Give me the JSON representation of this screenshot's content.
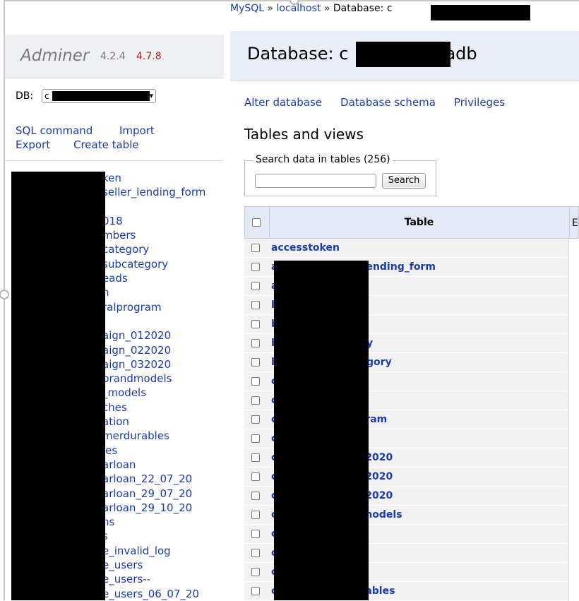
{
  "breadcrumb": {
    "part1": "MySQL",
    "sep1": " » ",
    "part2": "localhost",
    "sep2": " » ",
    "part3": "Database: c"
  },
  "brand": {
    "name": "Adminer",
    "version": "4.2.4",
    "new_version": "4.7.8"
  },
  "db_selector": {
    "label": "DB:",
    "value": "c"
  },
  "sidebar_links": {
    "sql_command": "SQL command",
    "import": "Import",
    "export": "Export",
    "create_table": "Create table"
  },
  "sidebar_tables": [
    "ken",
    "seller_lending_form",
    "",
    "018",
    "mbers",
    "category",
    "subcategory",
    "eads",
    "n",
    "ralprogram",
    "",
    "aign_012020",
    "aign_022020",
    "aign_032020",
    "brandmodels",
    "_models",
    "ches",
    "ation",
    "merdurables",
    "les",
    "arloan",
    "arloan_22_07_20",
    "arloan_29_07_20",
    "arloan_29_10_20",
    "ns",
    "s",
    "e_invalid_log",
    "e_users",
    "e_users--",
    "e_users_06_07_20"
  ],
  "main": {
    "title_prefix": "Database: c",
    "title_suffix": "adb",
    "actions": {
      "alter": "Alter database",
      "schema": "Database schema",
      "privileges": "Privileges"
    },
    "tables_heading": "Tables and views",
    "search": {
      "legend": "Search data in tables (256)",
      "button": "Search",
      "value": ""
    },
    "table_header": {
      "table": "Table",
      "engine_abbrev": "E"
    },
    "rows": [
      {
        "left": "accesstoken",
        "right": ""
      },
      {
        "left": "a",
        "right": "ending_form"
      },
      {
        "left": "a",
        "right": ""
      },
      {
        "left": "b",
        "right": ""
      },
      {
        "left": "b",
        "right": ""
      },
      {
        "left": "b",
        "right": "y"
      },
      {
        "left": "b",
        "right": "gory"
      },
      {
        "left": "c",
        "right": ""
      },
      {
        "left": "c",
        "right": ""
      },
      {
        "left": "c",
        "right": "ram"
      },
      {
        "left": "c",
        "right": ""
      },
      {
        "left": "c",
        "right": "2020"
      },
      {
        "left": "c",
        "right": "2020"
      },
      {
        "left": "c",
        "right": "2020"
      },
      {
        "left": "c",
        "right": "nodels"
      },
      {
        "left": "c",
        "right": ""
      },
      {
        "left": "c",
        "right": ""
      },
      {
        "left": "c",
        "right": ""
      },
      {
        "left": "c",
        "right": "ables"
      }
    ]
  },
  "colors": {
    "link": "#1a3bb5",
    "brand_header_bg": "#eef0f3",
    "db_header_bg": "#e9eef8",
    "new_version": "#c0221a"
  }
}
